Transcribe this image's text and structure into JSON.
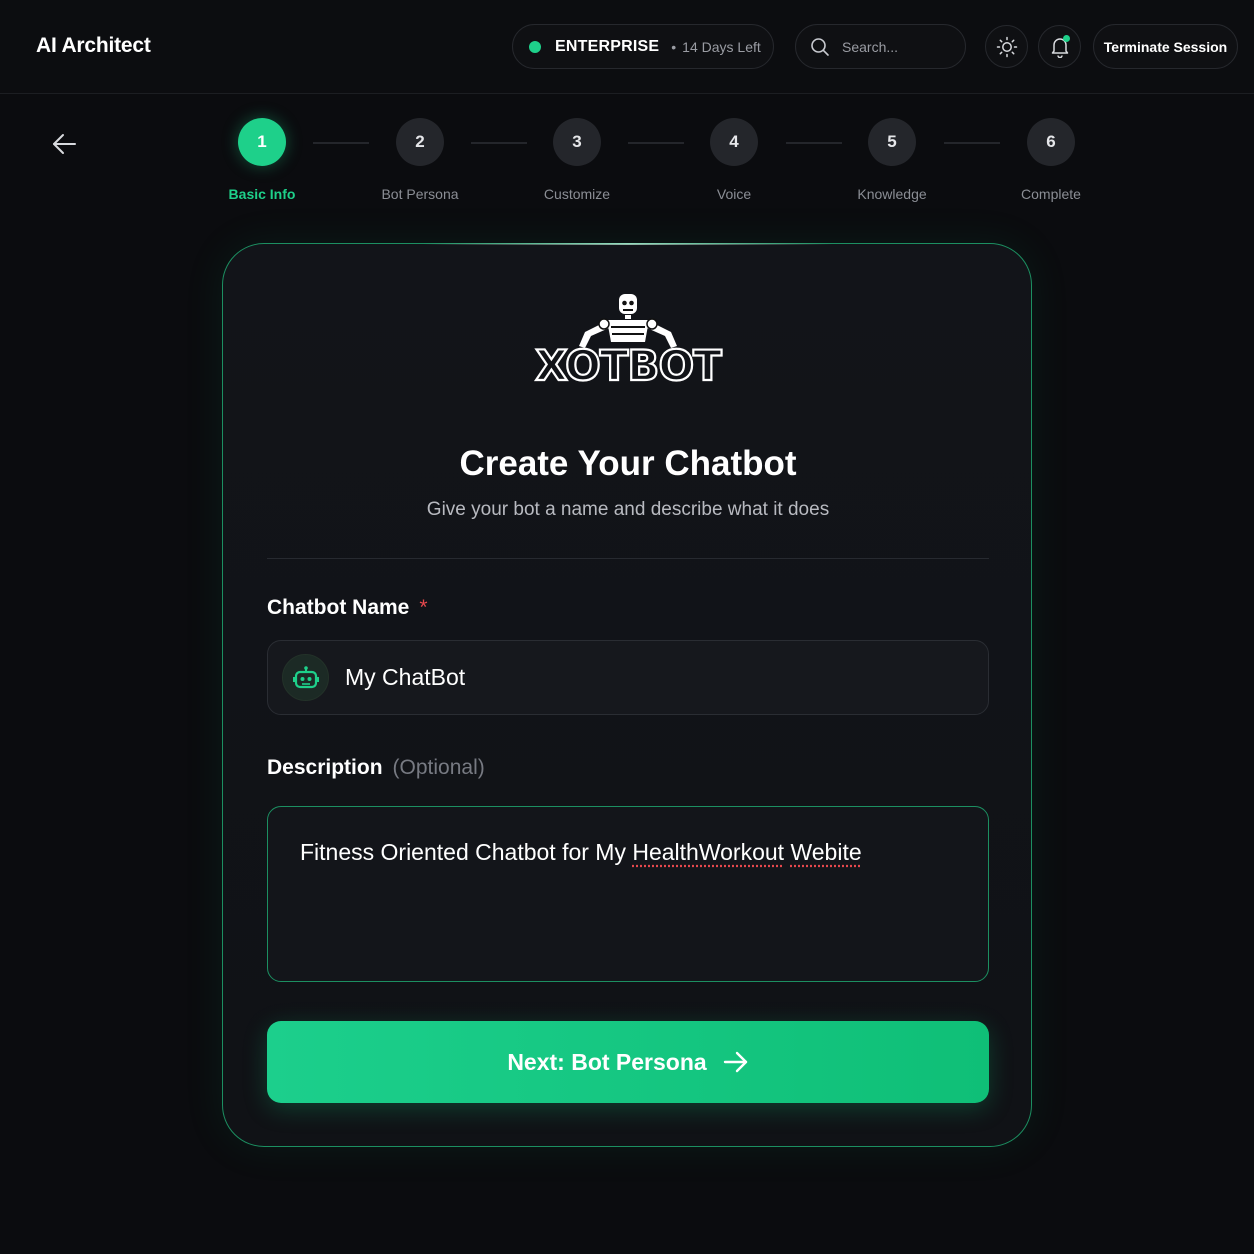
{
  "header": {
    "app_title": "AI Architect",
    "plan": {
      "name": "ENTERPRISE",
      "separator": "•",
      "days_left": "14 Days Left",
      "status_color": "#1ed08a"
    },
    "search": {
      "placeholder": "Search..."
    },
    "theme_icon": "sun-icon",
    "notification_icon": "bell-icon",
    "notification_unread": true,
    "terminate_label": "Terminate Session"
  },
  "stepper": {
    "current_step": 1,
    "steps": [
      {
        "number": "1",
        "label": "Basic Info",
        "active": true
      },
      {
        "number": "2",
        "label": "Bot Persona",
        "active": false
      },
      {
        "number": "3",
        "label": "Customize",
        "active": false
      },
      {
        "number": "4",
        "label": "Voice",
        "active": false
      },
      {
        "number": "5",
        "label": "Knowledge",
        "active": false
      },
      {
        "number": "6",
        "label": "Complete",
        "active": false
      }
    ]
  },
  "card": {
    "logo_text": "XOTBOT",
    "title": "Create Your Chatbot",
    "subtitle": "Give your bot a name and describe what it does",
    "name_field": {
      "label": "Chatbot Name",
      "required_mark": "*",
      "value": "My ChatBot",
      "icon": "robot-icon"
    },
    "description_field": {
      "label": "Description",
      "optional_note": "(Optional)",
      "value_plain": "Fitness Oriented Chatbot for My ",
      "value_misspelled_1": "HealthWorkout",
      "value_space": " ",
      "value_misspelled_2": "Webite"
    },
    "next_button": {
      "label": "Next: Bot Persona",
      "icon": "arrow-right-icon"
    }
  },
  "colors": {
    "accent": "#1ed08a",
    "background": "#0b0c0f",
    "card_border": "#1c8f61",
    "error": "#e5484d"
  }
}
